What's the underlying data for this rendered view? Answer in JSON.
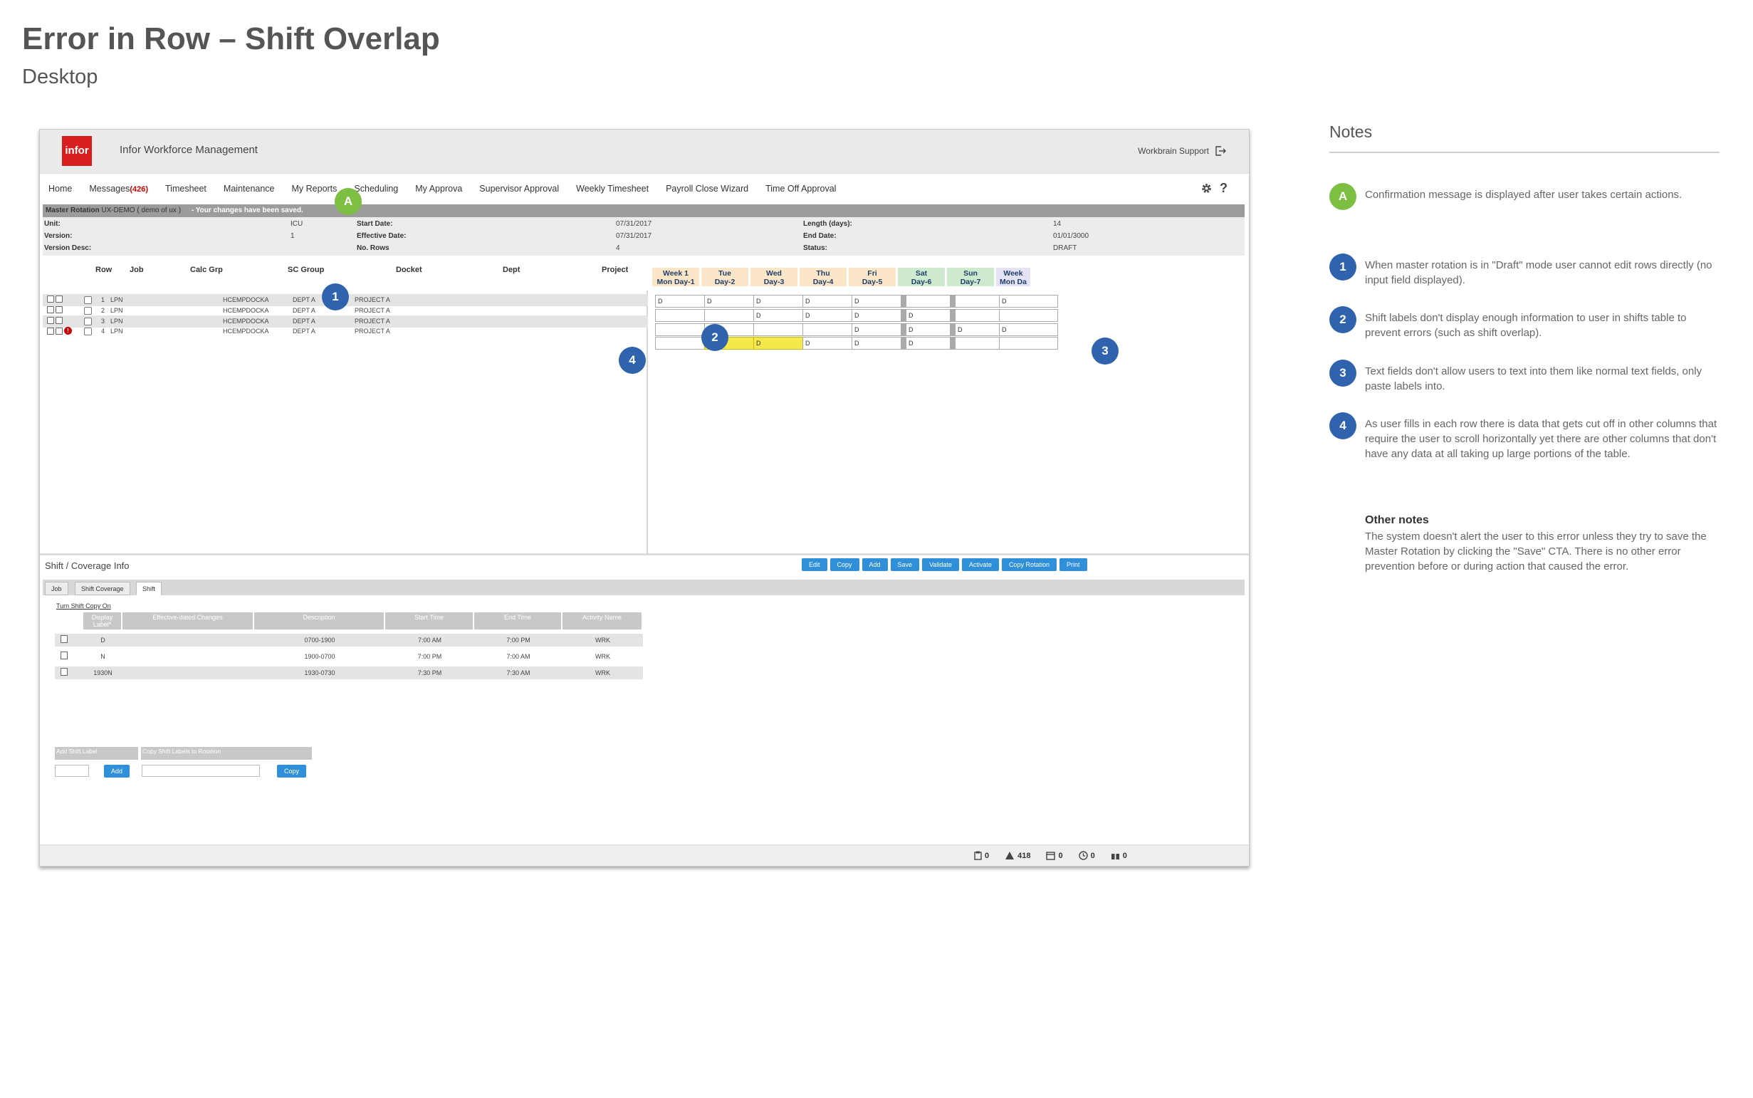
{
  "page": {
    "title": "Error in Row – Shift Overlap",
    "subtitle": "Desktop"
  },
  "app": {
    "logo": "infor",
    "name": "Infor Workforce Management",
    "support": "Workbrain Support",
    "nav": [
      {
        "label": "Home"
      },
      {
        "label": "Messages",
        "count": "(426)"
      },
      {
        "label": "Timesheet"
      },
      {
        "label": "Maintenance"
      },
      {
        "label": "My Reports"
      },
      {
        "label": "Scheduling"
      },
      {
        "label": "My Approva"
      },
      {
        "label": "Supervisor Approval"
      },
      {
        "label": "Weekly Timesheet"
      },
      {
        "label": "Payroll Close Wizard"
      },
      {
        "label": "Time Off Approval"
      }
    ],
    "help": "?",
    "message_bar": {
      "label": "Master Rotation",
      "name": "UX-DEMO  ( demo of ux )",
      "message": "- Your changes have been saved."
    },
    "info": {
      "unit_label": "Unit:",
      "unit": "ICU",
      "version_label": "Version:",
      "version": "1",
      "desc_label": "Version Desc:",
      "start_label": "Start Date:",
      "start": "07/31/2017",
      "eff_label": "Effective Date:",
      "eff": "07/31/2017",
      "rows_label": "No. Rows",
      "rows": "4",
      "length_label": "Length (days):",
      "length": "14",
      "end_label": "End Date:",
      "end": "01/01/3000",
      "status_label": "Status:",
      "status": "DRAFT"
    },
    "columns": [
      "Row",
      "Job",
      "Calc Grp",
      "SC Group",
      "Docket",
      "Dept",
      "Project"
    ],
    "days": [
      {
        "top": "Week 1",
        "bottom": "Mon Day-1",
        "color": "#fbe6c8"
      },
      {
        "top": "Tue",
        "bottom": "Day-2",
        "color": "#fbe6c8"
      },
      {
        "top": "Wed",
        "bottom": "Day-3",
        "color": "#fbe6c8"
      },
      {
        "top": "Thu",
        "bottom": "Day-4",
        "color": "#fbe6c8"
      },
      {
        "top": "Fri",
        "bottom": "Day-5",
        "color": "#fbe6c8"
      },
      {
        "top": "Sat",
        "bottom": "Day-6",
        "color": "#cdeacf"
      },
      {
        "top": "Sun",
        "bottom": "Day-7",
        "color": "#cdeacf"
      },
      {
        "top": "Week",
        "bottom": "Mon Da",
        "color": "#e3e3f3"
      }
    ],
    "rows": [
      {
        "num": "1",
        "job": "LPN",
        "docket": "HCEMPDOCKA",
        "dept": "DEPT A",
        "project": "PROJECT A",
        "cells": [
          "D",
          "D",
          "D",
          "D",
          "D",
          "",
          "",
          "D"
        ]
      },
      {
        "num": "2",
        "job": "LPN",
        "docket": "HCEMPDOCKA",
        "dept": "DEPT A",
        "project": "PROJECT A",
        "cells": [
          "",
          "",
          "D",
          "D",
          "D",
          "D",
          "",
          ""
        ]
      },
      {
        "num": "3",
        "job": "LPN",
        "docket": "HCEMPDOCKA",
        "dept": "DEPT A",
        "project": "PROJECT A",
        "cells": [
          "",
          "",
          "",
          "",
          "D",
          "D",
          "D",
          "D"
        ]
      },
      {
        "num": "4",
        "job": "LPN",
        "docket": "HCEMPDOCKA",
        "dept": "DEPT A",
        "project": "PROJECT A",
        "cells": [
          "",
          "1930N",
          "D",
          "D",
          "D",
          "D",
          "",
          ""
        ]
      }
    ],
    "error_icon": "!",
    "bottom": {
      "title": "Shift / Coverage Info",
      "buttons": [
        "Edit",
        "Copy",
        "Add",
        "Save",
        "Validate",
        "Activate",
        "Copy Rotation",
        "Print"
      ],
      "tabs": [
        "Job",
        "Shift Coverage",
        "Shift"
      ],
      "copy_toggle": "Turn Shift Copy On",
      "shift_headers": [
        "Display Label*",
        "Effective-dated Changes",
        "Description",
        "Start Time",
        "End Time",
        "Activity Name"
      ],
      "shifts": [
        {
          "label": "D",
          "desc": "0700-1900",
          "start": "7:00 AM",
          "end": "7:00 PM",
          "activity": "WRK"
        },
        {
          "label": "N",
          "desc": "1900-0700",
          "start": "7:00 PM",
          "end": "7:00 AM",
          "activity": "WRK"
        },
        {
          "label": "1930N",
          "desc": "1930-0730",
          "start": "7:30 PM",
          "end": "7:30 AM",
          "activity": "WRK"
        }
      ],
      "add_shift_label": "Add Shift Label",
      "add_button": "Add",
      "copy_labels": "Copy Shift Labels to Rotation",
      "copy_button": "Copy"
    },
    "status": [
      "0",
      "418",
      "0",
      "0",
      "0"
    ]
  },
  "markers": {
    "a": "A",
    "one": "1",
    "two": "2",
    "three": "3",
    "four": "4"
  },
  "notes": {
    "title": "Notes",
    "items": [
      {
        "marker": "A",
        "text": "Confirmation message is displayed after user takes certain actions."
      },
      {
        "marker": "1",
        "text": "When master rotation is in \"Draft\" mode user cannot edit rows directly (no input field displayed)."
      },
      {
        "marker": "2",
        "text": "Shift labels don't display enough information to user in shifts table to prevent errors (such as shift overlap)."
      },
      {
        "marker": "3",
        "text": "Text fields don't allow users to text into them like normal text fields, only paste labels into."
      },
      {
        "marker": "4",
        "text": "As user fills in each row there is data that gets cut off in other columns that require the user to scroll horizontally yet there are other columns that don't have any data at all taking up large portions of the table."
      }
    ],
    "other_title": "Other notes",
    "other_text": "The system doesn't alert the user to this error unless they try to save the Master Rotation by clicking the \"Save\" CTA. There is no other error prevention before or during action that caused the error."
  },
  "colors": {
    "marker_blue": "#2f63ad",
    "marker_green": "#7cbf42",
    "button_blue": "#2f8fd8",
    "error_yellow": "#f4e84a",
    "logo_red": "#d91e1e"
  }
}
